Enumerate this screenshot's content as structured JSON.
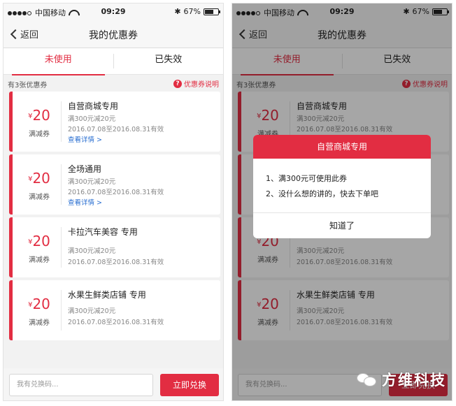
{
  "status": {
    "carrier": "中国移动",
    "time": "09:29",
    "battery": "67%",
    "battery_level": 0.67
  },
  "nav": {
    "back": "返回",
    "title": "我的优惠券"
  },
  "tabs": [
    {
      "label": "未使用"
    },
    {
      "label": "已失效"
    }
  ],
  "info": {
    "count": "有3张优惠券",
    "help": "优惠券说明",
    "help_icon": "?"
  },
  "coupons": [
    {
      "yen": "¥",
      "amount": "20",
      "type": "满减券",
      "title": "自营商城专用",
      "rule": "满300元减20元",
      "validity": "2016.07.08至2016.08.31有效",
      "link": "查看详情 >"
    },
    {
      "yen": "¥",
      "amount": "20",
      "type": "满减券",
      "title": "全场通用",
      "rule": "满300元减20元",
      "validity": "2016.07.08至2016.08.31有效",
      "link": "查看详情 >"
    },
    {
      "yen": "¥",
      "amount": "20",
      "type": "满减券",
      "title": "卡拉汽车美容 专用",
      "rule": "满300元减20元",
      "validity": "2016.07.08至2016.08.31有效"
    },
    {
      "yen": "¥",
      "amount": "20",
      "type": "满减券",
      "title": "水果生鲜类店铺 专用",
      "rule": "满300元减20元",
      "validity": "2016.07.08至2016.08.31有效"
    }
  ],
  "bottom": {
    "placeholder": "我有兑换码...",
    "redeem": "立即兑换"
  },
  "dialog": {
    "title": "自营商城专用",
    "lines": [
      "1、满300元可使用此券",
      "2、没什么想的讲的，快去下单吧"
    ],
    "ok": "知道了"
  },
  "watermark": {
    "text": "方维科技"
  },
  "colors": {
    "accent": "#e22d42",
    "link": "#2a6fd1"
  }
}
